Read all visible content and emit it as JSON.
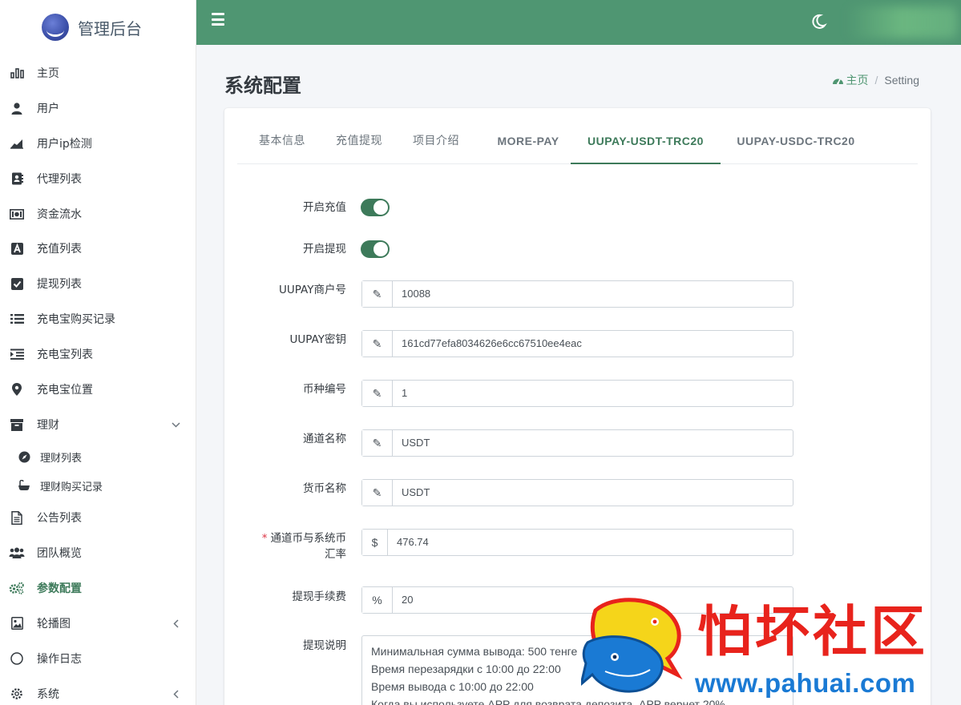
{
  "brand": {
    "title": "管理后台"
  },
  "sidebar": {
    "items": [
      {
        "label": "主页",
        "icon": "bar-chart-icon"
      },
      {
        "label": "用户",
        "icon": "user-icon"
      },
      {
        "label": "用户ip检测",
        "icon": "area-chart-icon"
      },
      {
        "label": "代理列表",
        "icon": "address-book-icon"
      },
      {
        "label": "资金流水",
        "icon": "money-bill-icon"
      },
      {
        "label": "充值列表",
        "icon": "font-box-icon"
      },
      {
        "label": "提现列表",
        "icon": "check-square-icon"
      },
      {
        "label": "充电宝购买记录",
        "icon": "list-icon"
      },
      {
        "label": "充电宝列表",
        "icon": "indent-list-icon"
      },
      {
        "label": "充电宝位置",
        "icon": "map-marker-icon"
      },
      {
        "label": "理财",
        "icon": "archive-icon"
      },
      {
        "label": "理财列表",
        "icon": "compass-icon"
      },
      {
        "label": "理财购买记录",
        "icon": "bath-icon"
      },
      {
        "label": "公告列表",
        "icon": "file-text-icon"
      },
      {
        "label": "团队概览",
        "icon": "users-icon"
      },
      {
        "label": "参数配置",
        "icon": "cogs-icon"
      },
      {
        "label": "轮播图",
        "icon": "image-icon"
      },
      {
        "label": "操作日志",
        "icon": "circle-icon"
      },
      {
        "label": "系统",
        "icon": "gear-icon"
      }
    ]
  },
  "header": {
    "menu_icon": "hamburger-icon",
    "theme_icon": "moon-icon"
  },
  "page": {
    "title": "系统配置",
    "breadcrumb": {
      "home": "主页",
      "current": "Setting"
    }
  },
  "tabs": [
    {
      "label": "基本信息"
    },
    {
      "label": "充值提现"
    },
    {
      "label": "项目介绍"
    },
    {
      "label": "MORE-PAY"
    },
    {
      "label": "UUPAY-USDT-TRC20",
      "active": true
    },
    {
      "label": "UUPAY-USDC-TRC20"
    }
  ],
  "form": {
    "enable_recharge": {
      "label": "开启充值",
      "on": true
    },
    "enable_withdraw": {
      "label": "开启提现",
      "on": true
    },
    "merchant_no": {
      "label": "UUPAY商户号",
      "value": "10088",
      "prefix": "✎"
    },
    "secret_key": {
      "label": "UUPAY密钥",
      "value": "161cd77efa8034626e6cc67510ee4eac",
      "prefix": "✎"
    },
    "currency_code": {
      "label": "币种编号",
      "value": "1",
      "prefix": "✎"
    },
    "channel_name": {
      "label": "通道名称",
      "value": "USDT",
      "prefix": "✎"
    },
    "currency_name": {
      "label": "货币名称",
      "value": "USDT",
      "prefix": "✎"
    },
    "exchange_rate": {
      "required_mark": "*",
      "label_line1": "通道币与系统币",
      "label_line2": "汇率",
      "value": "476.74",
      "prefix": "$"
    },
    "withdraw_fee": {
      "label": "提现手续费",
      "value": "20",
      "prefix": "%"
    },
    "withdraw_note": {
      "label": "提现说明",
      "lines": [
        "Минимальная сумма вывода: 500 тенге",
        "Время перезарядки с 10:00 до 22:00",
        "Время вывода с 10:00 до 22:00",
        "Когда вы используете APP для возврата депозита, APP вернет 20%"
      ]
    }
  },
  "watermark": {
    "text": "怕坏社区",
    "url": "www.pahuai.com"
  },
  "colors": {
    "accent": "#4f9672",
    "active_text": "#3d7a5a",
    "required": "#dc3545",
    "watermark_red": "#e8231c",
    "watermark_blue": "#1a7ad4"
  }
}
